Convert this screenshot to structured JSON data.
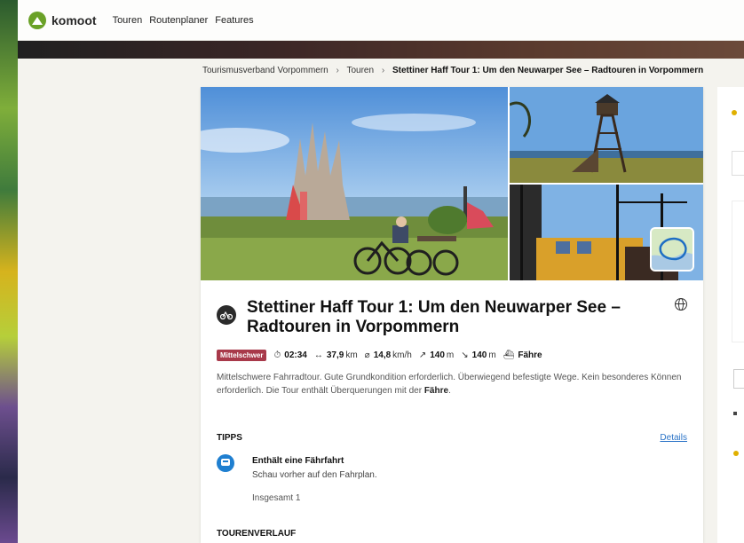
{
  "app": {
    "brand": "komoot",
    "brand_color": "#6aa127"
  },
  "nav": {
    "items": [
      "Touren",
      "Routenplaner",
      "Features"
    ]
  },
  "breadcrumb": {
    "items": [
      "Tourismusverband Vorpommern",
      "Touren"
    ],
    "current": "Stettiner Haff Tour 1: Um den Neuwarper See – Radtouren in Vorpommern"
  },
  "tour": {
    "title": "Stettiner Haff Tour 1: Um den Neuwarper See – Radtouren in Vorpommern",
    "sport_icon": "bike-icon",
    "difficulty": "Mittelschwer",
    "difficulty_color": "#a8394a",
    "duration": "02:34",
    "distance_value": "37,9",
    "distance_unit": "km",
    "speed_value": "14,8",
    "speed_unit": "km/h",
    "uphill_value": "140",
    "uphill_unit": "m",
    "downhill_value": "140",
    "downhill_unit": "m",
    "transport": "Fähre",
    "description_part1": "Mittelschwere Fahrradtour. Gute Grundkondition erforderlich. Überwiegend befestigte Wege. Kein besonderes Können erforderlich. Die Tour enthält Überquerungen mit der ",
    "description_bold": "Fähre",
    "description_end": "."
  },
  "tips": {
    "heading": "TIPPS",
    "details_link": "Details",
    "item_title": "Enthält eine Fährfahrt",
    "item_text": "Schau vorher auf den Fahrplan.",
    "total": "Insgesamt 1",
    "link_color": "#2a73c7"
  },
  "route": {
    "heading": "TOURENVERLAUF"
  }
}
